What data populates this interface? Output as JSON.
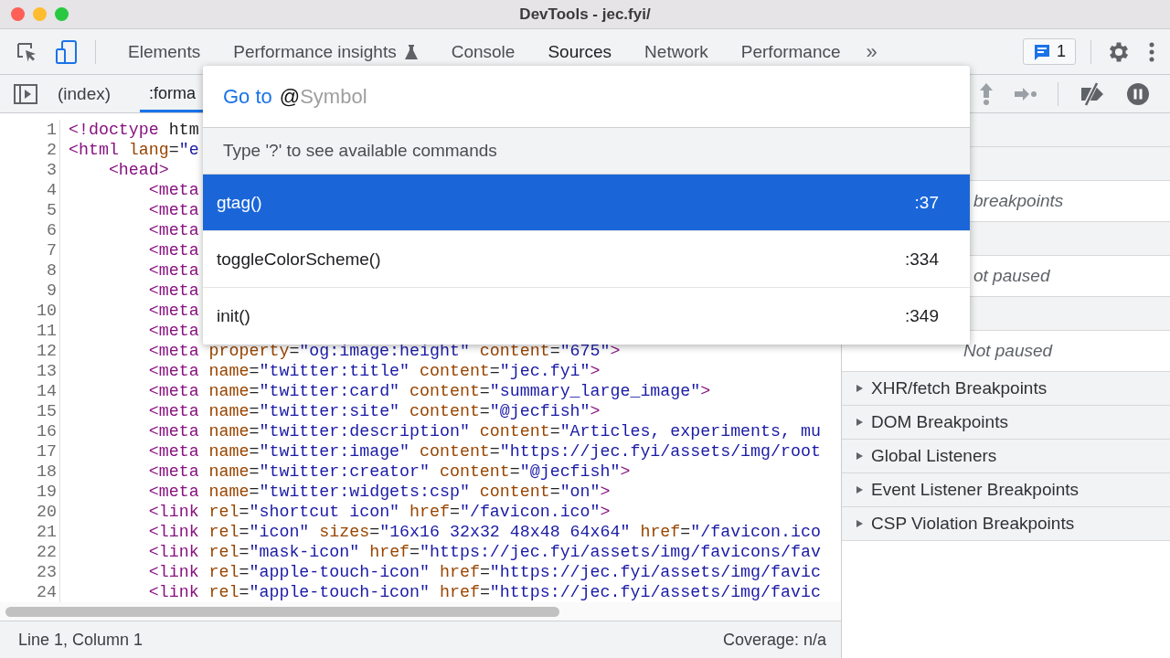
{
  "window": {
    "title": "DevTools - jec.fyi/"
  },
  "main_tabs": [
    {
      "label": "Elements",
      "selected": false,
      "experimental": false
    },
    {
      "label": "Performance insights",
      "selected": false,
      "experimental": true
    },
    {
      "label": "Console",
      "selected": false,
      "experimental": false
    },
    {
      "label": "Sources",
      "selected": true,
      "experimental": false
    },
    {
      "label": "Network",
      "selected": false,
      "experimental": false
    },
    {
      "label": "Performance",
      "selected": false,
      "experimental": false
    }
  ],
  "more_tabs": "»",
  "issues_count": "1",
  "file_tabs": [
    {
      "label": "(index)",
      "selected": false
    },
    {
      "label": ":forma",
      "selected": true
    }
  ],
  "editor": {
    "lines": [
      {
        "n": "1",
        "code": "<!doctype htm"
      },
      {
        "n": "2",
        "code": "<html lang=\"e"
      },
      {
        "n": "3",
        "code": "    <head>"
      },
      {
        "n": "4",
        "code": "        <meta"
      },
      {
        "n": "5",
        "code": "        <meta"
      },
      {
        "n": "6",
        "code": "        <meta"
      },
      {
        "n": "7",
        "code": "        <meta"
      },
      {
        "n": "8",
        "code": "        <meta"
      },
      {
        "n": "9",
        "code": "        <meta"
      },
      {
        "n": "10",
        "code": "        <meta"
      },
      {
        "n": "11",
        "code": "        <meta"
      },
      {
        "n": "12",
        "code": "        <meta property=\"og:image:height\" content=\"675\">"
      },
      {
        "n": "13",
        "code": "        <meta name=\"twitter:title\" content=\"jec.fyi\">"
      },
      {
        "n": "14",
        "code": "        <meta name=\"twitter:card\" content=\"summary_large_image\">"
      },
      {
        "n": "15",
        "code": "        <meta name=\"twitter:site\" content=\"@jecfish\">"
      },
      {
        "n": "16",
        "code": "        <meta name=\"twitter:description\" content=\"Articles, experiments, mu"
      },
      {
        "n": "17",
        "code": "        <meta name=\"twitter:image\" content=\"https://jec.fyi/assets/img/root"
      },
      {
        "n": "18",
        "code": "        <meta name=\"twitter:creator\" content=\"@jecfish\">"
      },
      {
        "n": "19",
        "code": "        <meta name=\"twitter:widgets:csp\" content=\"on\">"
      },
      {
        "n": "20",
        "code": "        <link rel=\"shortcut icon\" href=\"/favicon.ico\">"
      },
      {
        "n": "21",
        "code": "        <link rel=\"icon\" sizes=\"16x16 32x32 48x48 64x64\" href=\"/favicon.ico"
      },
      {
        "n": "22",
        "code": "        <link rel=\"mask-icon\" href=\"https://jec.fyi/assets/img/favicons/fav"
      },
      {
        "n": "23",
        "code": "        <link rel=\"apple-touch-icon\" href=\"https://jec.fyi/assets/img/favic"
      },
      {
        "n": "24",
        "code": "        <link rel=\"apple-touch-icon\" href=\"https://jec.fyi/assets/img/favic"
      }
    ]
  },
  "status_bar": {
    "position": "Line 1, Column 1",
    "coverage": "Coverage: n/a"
  },
  "debugger": {
    "messages": [
      {
        "kind": "clipped",
        "text": "breakpoints"
      },
      {
        "kind": "clipped",
        "text": "ot paused"
      },
      {
        "kind": "full",
        "text": "Not paused"
      }
    ],
    "sections": [
      {
        "title": "XHR/fetch Breakpoints",
        "expanded": false
      },
      {
        "title": "DOM Breakpoints",
        "expanded": false
      },
      {
        "title": "Global Listeners",
        "expanded": false
      },
      {
        "title": "Event Listener Breakpoints",
        "expanded": false
      },
      {
        "title": "CSP Violation Breakpoints",
        "expanded": false
      }
    ]
  },
  "quick_open": {
    "prefix": "Go to",
    "value": "@",
    "hint": "Symbol",
    "help": "Type '?' to see available commands",
    "items": [
      {
        "label": "gtag()",
        "line": ":37",
        "selected": true
      },
      {
        "label": "toggleColorScheme()",
        "line": ":334",
        "selected": false
      },
      {
        "label": "init()",
        "line": ":349",
        "selected": false
      }
    ]
  }
}
